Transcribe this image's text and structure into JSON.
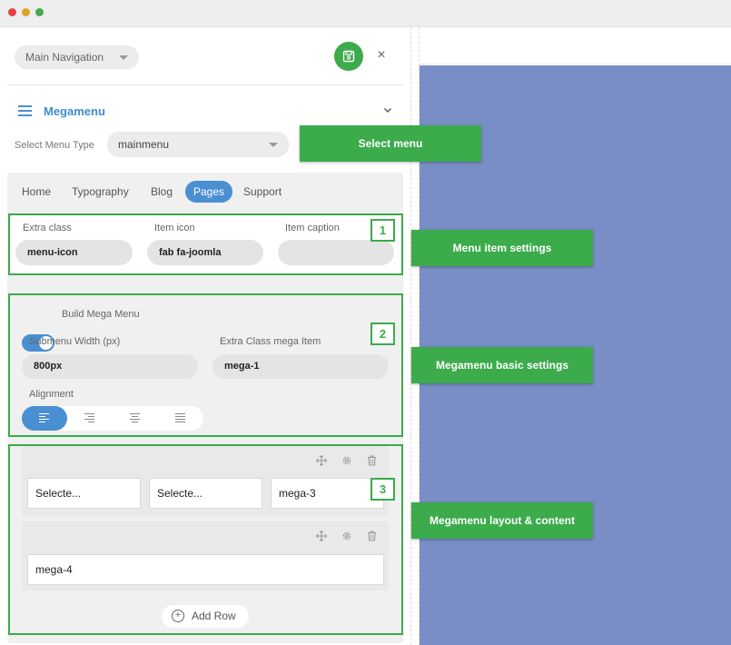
{
  "colors": {
    "accent": "#4a8fd1",
    "annotation": "#3bab4b",
    "preview_bg": "#798dc6"
  },
  "window": {
    "dots": [
      "#e0443e",
      "#dea123",
      "#4aa94c"
    ]
  },
  "header": {
    "nav_select": "Main Navigation",
    "save_icon": "floppy-disk-icon",
    "close_icon": "×"
  },
  "megamenu": {
    "title": "Megamenu",
    "menu_type_label": "Select Menu Type",
    "menu_type_value": "mainmenu"
  },
  "tabs": [
    {
      "label": "Home",
      "active": false
    },
    {
      "label": "Typography",
      "active": false
    },
    {
      "label": "Blog",
      "active": false
    },
    {
      "label": "Pages",
      "active": true
    },
    {
      "label": "Support",
      "active": false
    }
  ],
  "item_settings": {
    "extra_class_label": "Extra class",
    "extra_class_value": "menu-icon",
    "item_icon_label": "Item icon",
    "item_icon_value": "fab fa-joomla",
    "item_caption_label": "Item caption",
    "item_caption_value": ""
  },
  "mega_settings": {
    "build_label": "Build Mega Menu",
    "build_enabled": true,
    "submenu_width_label": "Submenu Width (px)",
    "submenu_width_value": "800px",
    "extra_class_label": "Extra Class mega Item",
    "extra_class_value": "mega-1",
    "alignment_label": "Alignment",
    "alignment_options": [
      "left",
      "right",
      "center",
      "justify"
    ],
    "alignment_selected": "left"
  },
  "layout": {
    "rows": [
      {
        "columns": [
          "Selecte...",
          "Selecte...",
          "mega-3"
        ]
      },
      {
        "columns": [
          "mega-4"
        ]
      }
    ],
    "add_row_label": "Add Row"
  },
  "callouts": {
    "select_menu": "Select menu",
    "item_settings": "Menu item settings",
    "basic_settings": "Megamenu basic settings",
    "layout_content": "Megamenu layout & content",
    "num1": "1",
    "num2": "2",
    "num3": "3"
  }
}
